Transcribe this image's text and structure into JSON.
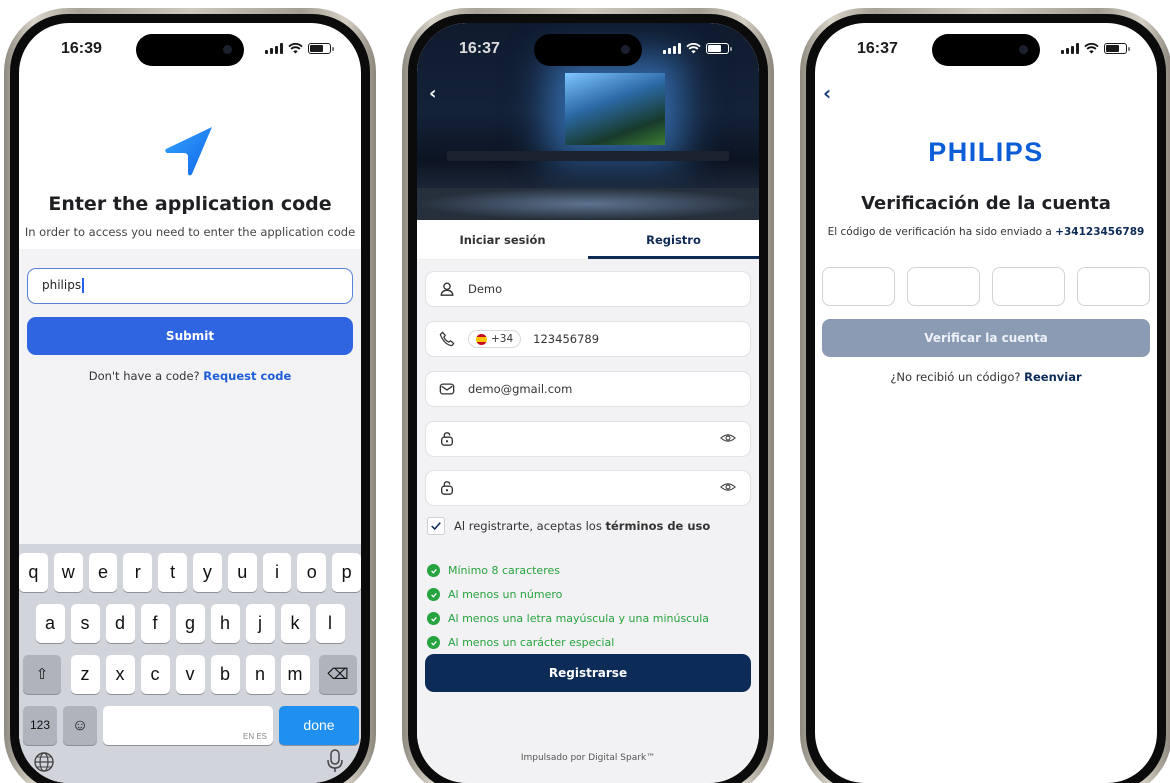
{
  "phone1": {
    "time": "16:39",
    "title": "Enter the application code",
    "subtitle": "In order to access you need to enter the application code",
    "input_value": "philips",
    "submit_label": "Submit",
    "no_code_text": "Don't have a code?",
    "request_link": "Request code",
    "keyboard": {
      "row1": [
        "q",
        "w",
        "e",
        "r",
        "t",
        "y",
        "u",
        "i",
        "o",
        "p"
      ],
      "row2": [
        "a",
        "s",
        "d",
        "f",
        "g",
        "h",
        "j",
        "k",
        "l"
      ],
      "row3": [
        "z",
        "x",
        "c",
        "v",
        "b",
        "n",
        "m"
      ],
      "numbers_key": "123",
      "space_lang": "EN ES",
      "done_key": "done"
    },
    "accent": "#2f65e0"
  },
  "phone2": {
    "time": "16:37",
    "tabs": [
      {
        "label": "Iniciar sesión",
        "active": false
      },
      {
        "label": "Registro",
        "active": true
      }
    ],
    "name_value": "Demo",
    "country_code": "+34",
    "phone_value": "123456789",
    "email_value": "demo@gmail.com",
    "terms_prefix": "Al registrarte, aceptas los",
    "terms_link": "términos de uso",
    "rules": [
      "Mínimo 8 caracteres",
      "Al menos un número",
      "Al menos una letra mayúscula y una minúscula",
      "Al menos un carácter especial"
    ],
    "register_label": "Registrarse",
    "powered_by": "Impulsado por Digital Spark™",
    "accent": "#0c2b57",
    "success_color": "#27a33f"
  },
  "phone3": {
    "time": "16:37",
    "brand": "PHILIPS",
    "title": "Verificación de la cuenta",
    "subtitle": "El código de verificación ha sido enviado a",
    "phone_number": "+34123456789",
    "verify_label": "Verificar la cuenta",
    "resend_prefix": "¿No recibió un código?",
    "resend_link": "Reenviar",
    "brand_color": "#0b5ed7"
  }
}
